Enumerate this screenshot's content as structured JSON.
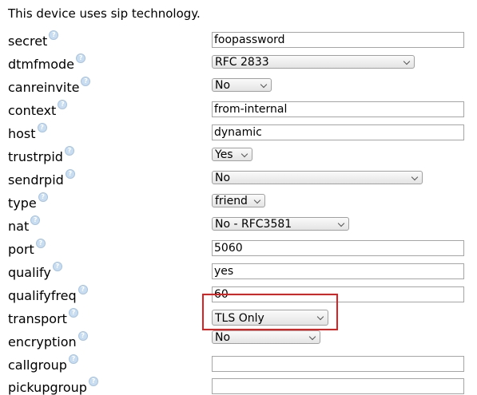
{
  "intro": "This device uses sip technology.",
  "help_glyph": "?",
  "fields": [
    {
      "label": "secret",
      "kind": "input",
      "value": "foopassword"
    },
    {
      "label": "dtmfmode",
      "kind": "select",
      "value": "RFC 2833"
    },
    {
      "label": "canreinvite",
      "kind": "select",
      "value": "No"
    },
    {
      "label": "context",
      "kind": "input",
      "value": "from-internal"
    },
    {
      "label": "host",
      "kind": "input",
      "value": "dynamic"
    },
    {
      "label": "trustrpid",
      "kind": "select",
      "value": "Yes"
    },
    {
      "label": "sendrpid",
      "kind": "select",
      "value": "No"
    },
    {
      "label": "type",
      "kind": "select",
      "value": "friend"
    },
    {
      "label": "nat",
      "kind": "select",
      "value": "No - RFC3581"
    },
    {
      "label": "port",
      "kind": "input",
      "value": "5060"
    },
    {
      "label": "qualify",
      "kind": "input",
      "value": "yes"
    },
    {
      "label": "qualifyfreq",
      "kind": "input",
      "value": "60"
    },
    {
      "label": "transport",
      "kind": "select",
      "value": "TLS Only"
    },
    {
      "label": "encryption",
      "kind": "select",
      "value": "No"
    },
    {
      "label": "callgroup",
      "kind": "input",
      "value": ""
    },
    {
      "label": "pickupgroup",
      "kind": "input",
      "value": ""
    }
  ],
  "highlight_color": "#e02020"
}
